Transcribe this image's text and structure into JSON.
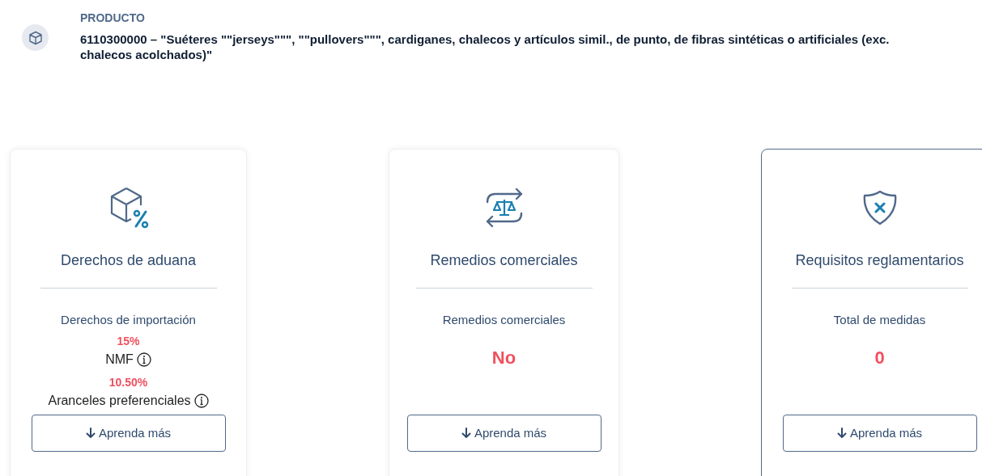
{
  "product": {
    "label": "PRODUCTO",
    "description": "6110300000 – \"Suéteres \"\"jerseys\"\"\", \"\"pullovers\"\"\", cardiganes, chalecos y artículos simil., de punto, de fibras sintéticas o artificiales (exc. chalecos acolchados)\""
  },
  "cards": [
    {
      "title": "Derechos de aduana",
      "selected": false,
      "subtitle": "Derechos de importación",
      "kind": "rates",
      "rates": [
        {
          "value": "15%",
          "label": "NMF"
        },
        {
          "value": "10.50%",
          "label": "Aranceles preferenciales"
        }
      ],
      "button": "Aprenda más"
    },
    {
      "title": "Remedios comerciales",
      "selected": false,
      "subtitle": "Remedios comerciales",
      "kind": "value",
      "value": "No",
      "button": "Aprenda más"
    },
    {
      "title": "Requisitos reglamentarios",
      "selected": true,
      "subtitle": "Total de medidas",
      "kind": "value",
      "value": "0",
      "button": "Aprenda más"
    }
  ]
}
